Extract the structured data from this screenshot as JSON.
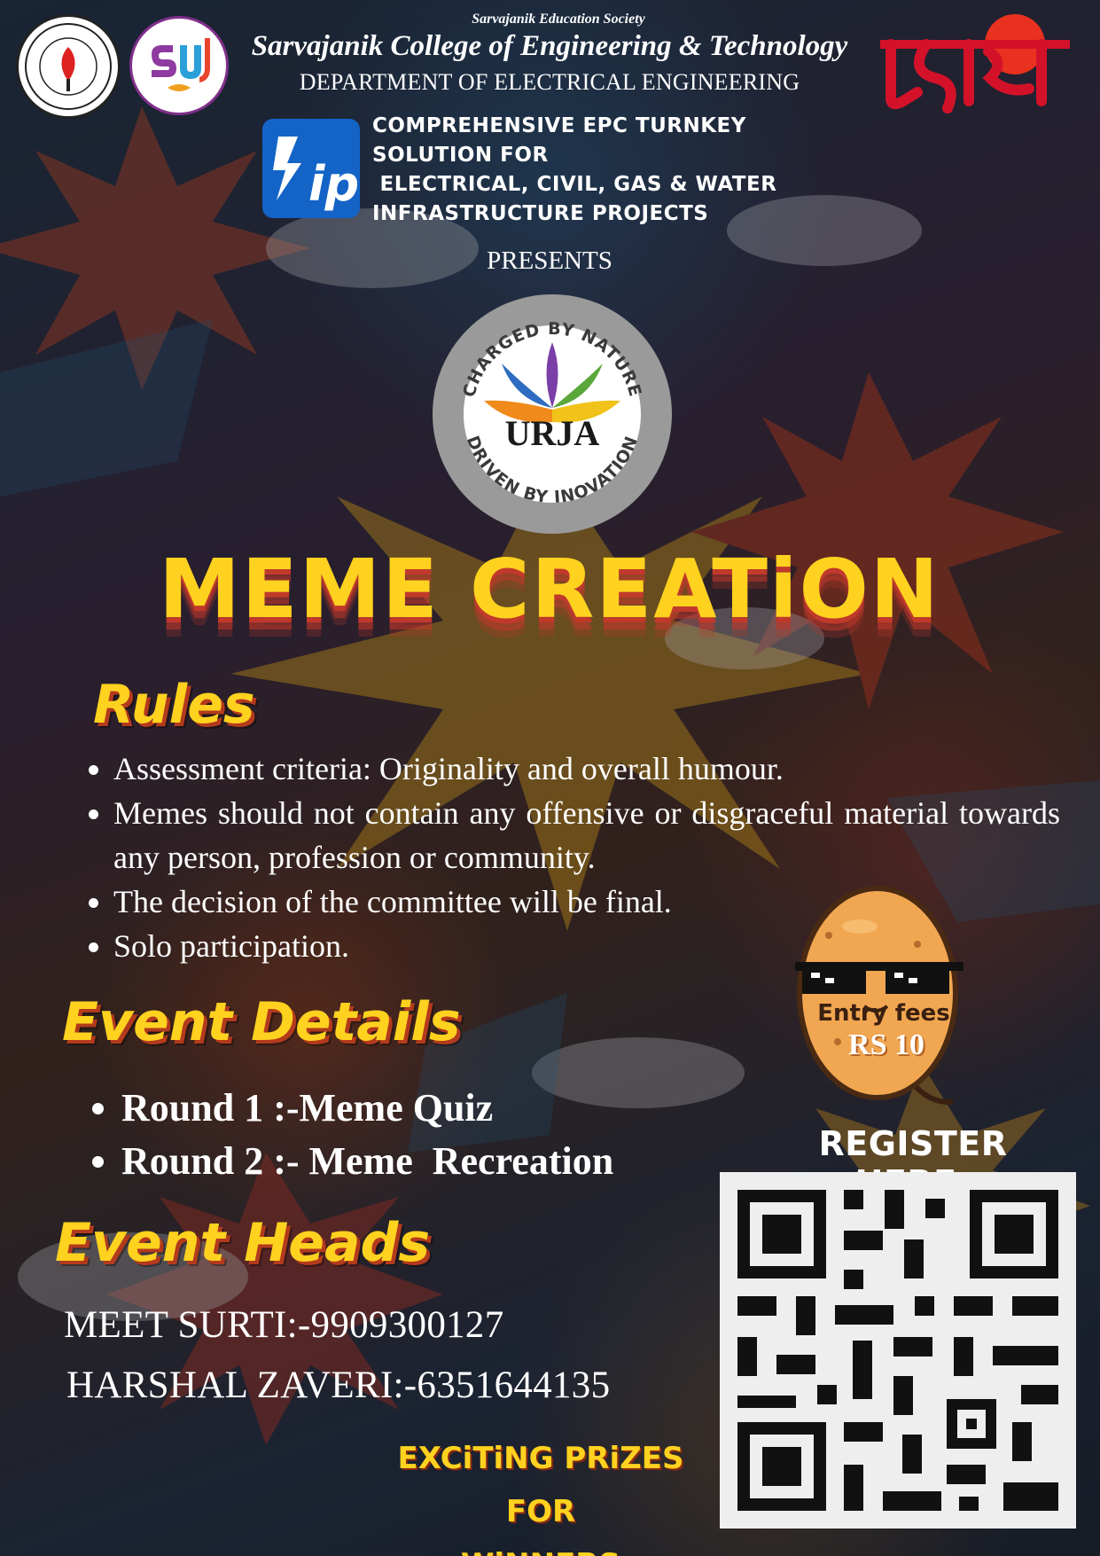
{
  "header": {
    "society": "Sarvajanik Education Society",
    "college": "Sarvajanik College of Engineering & Technology",
    "department": "DEPARTMENT OF ELECTRICAL ENGINEERING",
    "logos": [
      "sces-logo",
      "svu-logo",
      "kshitij-logo"
    ]
  },
  "sponsor": {
    "logo": "ip-logo",
    "lines": [
      "COMPREHENSIVE EPC TURNKEY",
      "SOLUTION FOR",
      " ELECTRICAL, CIVIL, GAS & WATER",
      "INFRASTRUCTURE PROJECTS"
    ]
  },
  "presents": "PRESENTS",
  "badge": {
    "top_text": "CHARGED BY NATURE",
    "name": "URJA",
    "bottom_text": "DRIVEN BY INOVATION"
  },
  "title": "MEME CREATiON",
  "rules": {
    "heading": "Rules",
    "items": [
      "Assessment criteria: Originality and overall humour.",
      "Memes should not contain any offensive or disgraceful material towards any person, profession or community.",
      "The decision of the committee will be final.",
      "Solo participation."
    ]
  },
  "event_details": {
    "heading": "Event Details",
    "items": [
      "Round 1 :-Meme Quiz",
      "Round 2 :- Meme  Recreation"
    ]
  },
  "event_heads": {
    "heading": "Event Heads",
    "people": [
      "MEET SURTI:-9909300127",
      "HARSHAL ZAVERI:-6351644135"
    ]
  },
  "entry": {
    "label": "Entry fees",
    "amount": "RS 10"
  },
  "register": {
    "label": "REGISTER HERE:"
  },
  "prizes": {
    "line1": "EXCiTiNG PRiZES FOR",
    "line2": "WiNNERS"
  },
  "colors": {
    "accent_yellow": "#ffd21f",
    "accent_red": "#c0392b",
    "text_white": "#ffffff"
  }
}
